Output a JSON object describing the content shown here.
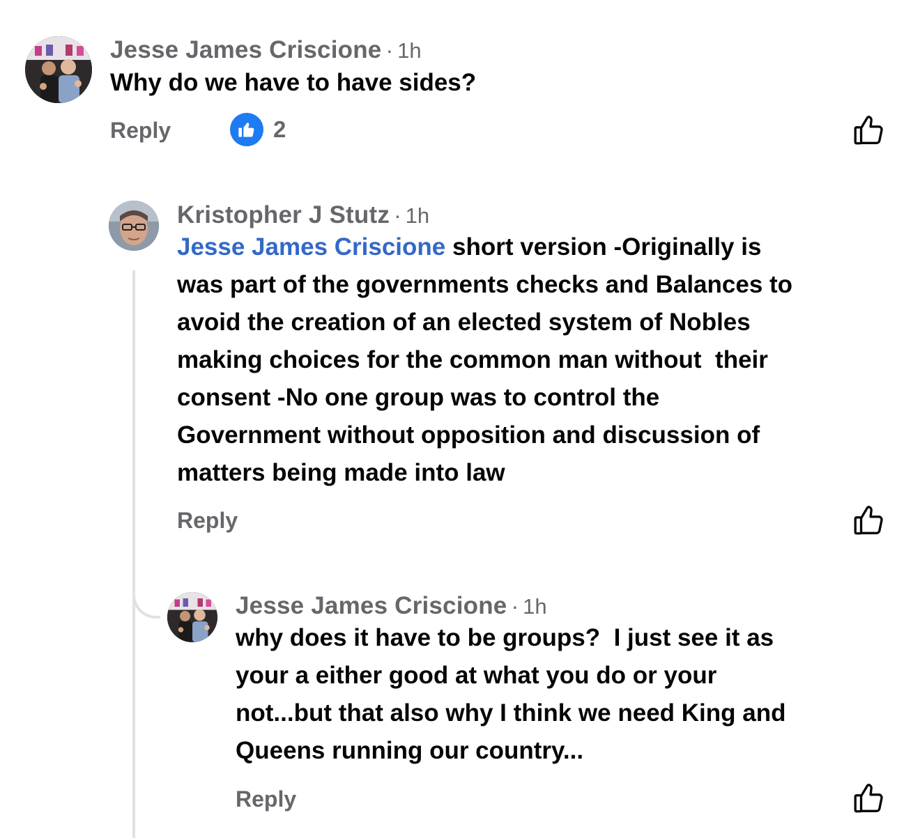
{
  "comments": [
    {
      "author": "Jesse James Criscione",
      "separator": "·",
      "time": "1h",
      "text": "Why do we have to have sides?",
      "reply_label": "Reply",
      "reaction": {
        "icon": "thumbs-up-icon",
        "count": "2"
      },
      "like_icon": "thumbs-up-outline-icon"
    },
    {
      "author": "Kristopher J Stutz",
      "separator": "·",
      "time": "1h",
      "mention": "Jesse James Criscione",
      "text": " short version -Originally is\nwas part of the governments checks and Balances to\navoid the creation of an elected system of Nobles\nmaking choices for the common man without  their\nconsent -No one group was to control the\nGovernment without opposition and discussion of\nmatters being made into law",
      "reply_label": "Reply",
      "like_icon": "thumbs-up-outline-icon"
    },
    {
      "author": "Jesse James Criscione",
      "separator": "·",
      "time": "1h",
      "text": "why does it have to be groups?  I just see it as\nyour a either good at what you do or your\nnot...but that also why I think we need King and\nQueens running our country...",
      "reply_label": "Reply",
      "like_icon": "thumbs-up-outline-icon"
    }
  ],
  "colors": {
    "meta_gray": "#65676b",
    "text": "#050505",
    "mention_blue": "#3468c8",
    "reaction_blue": "#1f7bf2",
    "thread_line": "#dfe1e5"
  }
}
